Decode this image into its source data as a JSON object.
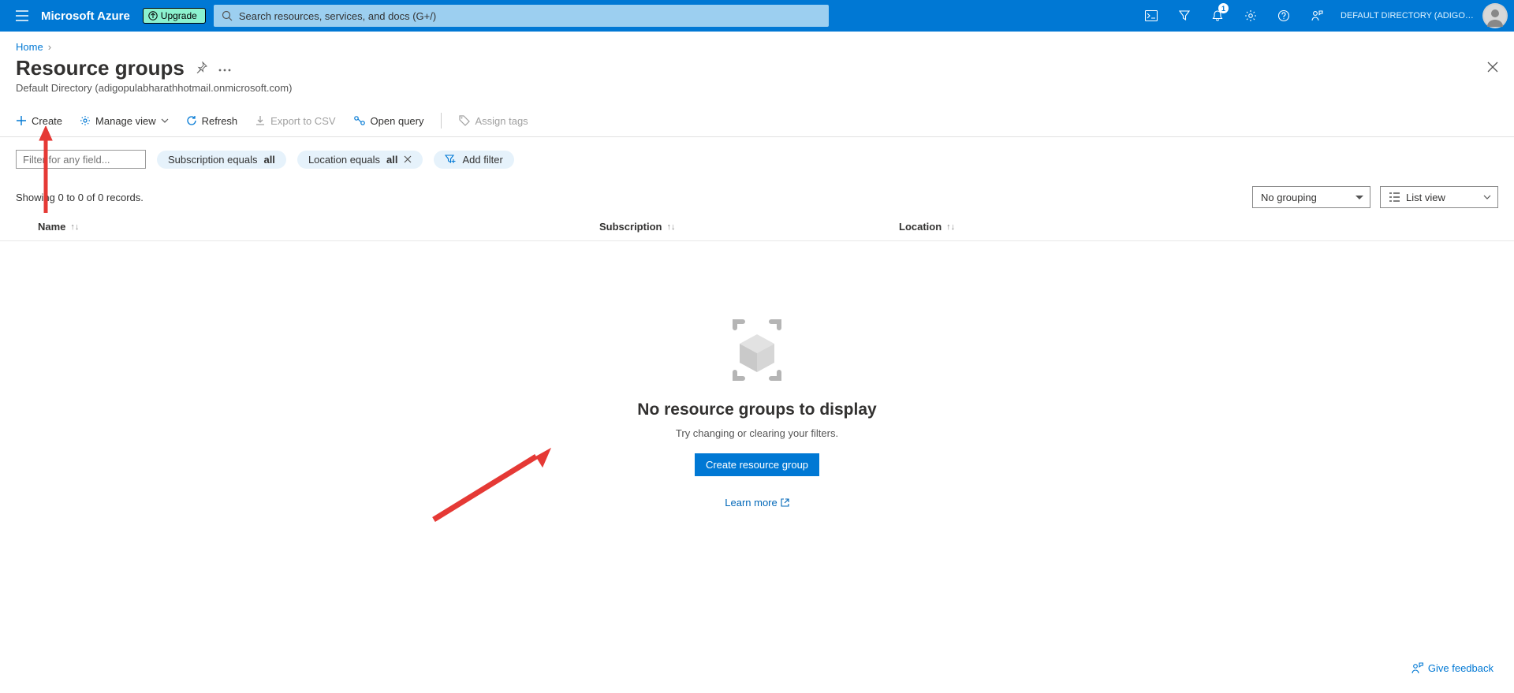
{
  "topbar": {
    "brand": "Microsoft Azure",
    "upgrade_label": "Upgrade",
    "search_placeholder": "Search resources, services, and docs (G+/)",
    "notification_badge": "1",
    "tenant_label": "DEFAULT DIRECTORY (ADIGOPUL..."
  },
  "breadcrumb": {
    "home": "Home"
  },
  "header": {
    "title": "Resource groups",
    "subtitle": "Default Directory (adigopulabharathhotmail.onmicrosoft.com)"
  },
  "toolbar": {
    "create": "Create",
    "manage_view": "Manage view",
    "refresh": "Refresh",
    "export_csv": "Export to CSV",
    "open_query": "Open query",
    "assign_tags": "Assign tags"
  },
  "filters": {
    "textbox_placeholder": "Filter for any field...",
    "subscription_label": "Subscription equals ",
    "subscription_value": "all",
    "location_label": "Location equals ",
    "location_value": "all",
    "add_filter": "Add filter"
  },
  "results": {
    "count_text": "Showing 0 to 0 of 0 records.",
    "grouping": "No grouping",
    "view_mode": "List view"
  },
  "columns": {
    "name": "Name",
    "subscription": "Subscription",
    "location": "Location"
  },
  "empty": {
    "title": "No resource groups to display",
    "hint": "Try changing or clearing your filters.",
    "create_btn": "Create resource group",
    "learn_more": "Learn more"
  },
  "feedback": {
    "label": "Give feedback"
  }
}
